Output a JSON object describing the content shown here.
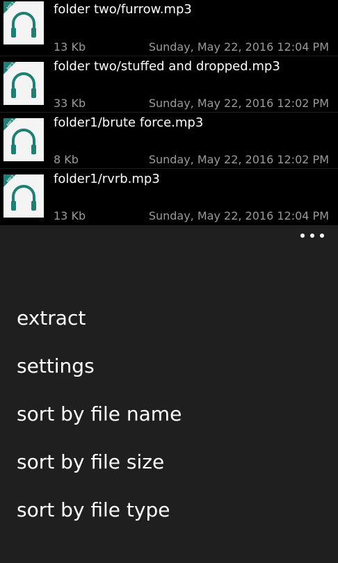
{
  "files": [
    {
      "name": "folder two/furrow.mp3",
      "size": "13 Kb",
      "date": "Sunday, May 22, 2016 12:04 PM",
      "icon": "mp3-file-icon"
    },
    {
      "name": "folder two/stuffed and dropped.mp3",
      "size": "33 Kb",
      "date": "Sunday, May 22, 2016 12:02 PM",
      "icon": "mp3-file-icon"
    },
    {
      "name": "folder1/brute force.mp3",
      "size": "8 Kb",
      "date": "Sunday, May 22, 2016 12:02 PM",
      "icon": "mp3-file-icon"
    },
    {
      "name": "folder1/rvrb.mp3",
      "size": "13 Kb",
      "date": "Sunday, May 22, 2016 12:04 PM",
      "icon": "mp3-file-icon"
    }
  ],
  "icon_badge": "MP3",
  "app_bar": {
    "more_icon": "ellipsis-icon",
    "menu": [
      "extract",
      "settings",
      "sort by file name",
      "sort by file size",
      "sort by file type"
    ]
  },
  "colors": {
    "icon_teal": "#1f7f74",
    "background": "#000000",
    "app_bar": "#1f1f1f",
    "secondary_text": "#9a9a9a"
  }
}
